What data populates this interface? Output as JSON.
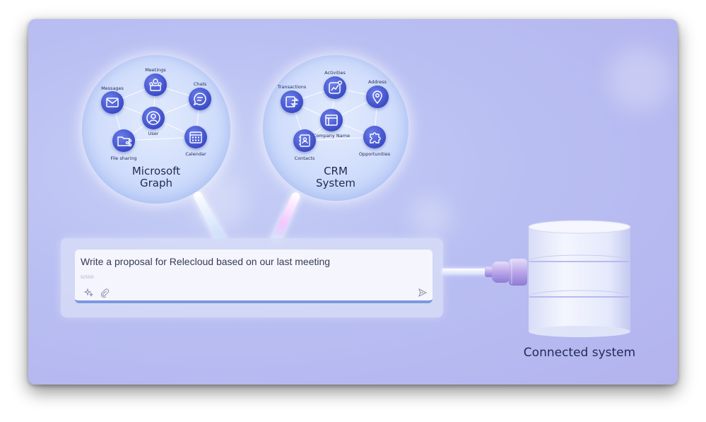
{
  "graph_bubble": {
    "title_line1": "Microsoft",
    "title_line2": "Graph",
    "nodes": [
      {
        "label": "Meetings",
        "icon": "meeting-people-icon"
      },
      {
        "label": "Messages",
        "icon": "mail-icon"
      },
      {
        "label": "Chats",
        "icon": "chat-bubble-icon"
      },
      {
        "label": "User",
        "icon": "user-icon"
      },
      {
        "label": "File sharing",
        "icon": "folder-share-icon"
      },
      {
        "label": "Calendar",
        "icon": "calendar-icon"
      }
    ]
  },
  "crm_bubble": {
    "title_line1": "CRM",
    "title_line2": "System",
    "nodes": [
      {
        "label": "Activities",
        "icon": "activity-chart-icon"
      },
      {
        "label": "Transactions",
        "icon": "transactions-icon"
      },
      {
        "label": "Address",
        "icon": "location-pin-icon"
      },
      {
        "label": "Company Name",
        "icon": "company-window-icon"
      },
      {
        "label": "Contacts",
        "icon": "contacts-book-icon"
      },
      {
        "label": "Opportunities",
        "icon": "puzzle-icon"
      }
    ]
  },
  "prompt": {
    "text": "Write a proposal for Relecloud based on our last meeting",
    "char_count": "0/500",
    "sparkle_icon": "sparkle-icon",
    "attach_icon": "paperclip-icon",
    "send_icon": "send-icon"
  },
  "connected_system": {
    "label": "Connected system",
    "icon": "database-cylinder-icon"
  },
  "colors": {
    "background": "#b9bff2",
    "node_blue": "#3b4cc7",
    "text_dark": "#1f2a55",
    "prompt_underline": "#7d97df"
  }
}
